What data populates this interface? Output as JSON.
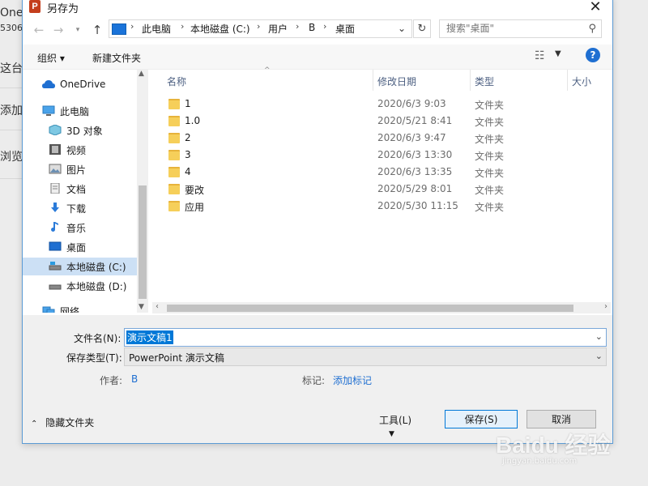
{
  "background": {
    "lines": [
      "OneD",
      "5306",
      "这台电",
      "添加位",
      "浏览"
    ]
  },
  "dialog": {
    "app_icon_label": "P",
    "title": "另存为",
    "close_glyph": "✕"
  },
  "address": {
    "crumbs": [
      "此电脑",
      "本地磁盘 (C:)",
      "用户",
      "B",
      "桌面"
    ],
    "search_placeholder": "搜索\"桌面\""
  },
  "toolbar": {
    "organize": "组织 ▾",
    "new_folder": "新建文件夹",
    "help_glyph": "?"
  },
  "nav": {
    "items": [
      {
        "label": "OneDrive",
        "icon": "cloud-icon"
      },
      {
        "label": "此电脑",
        "icon": "computer-icon"
      },
      {
        "label": "3D 对象",
        "icon": "cube-icon"
      },
      {
        "label": "视频",
        "icon": "video-icon"
      },
      {
        "label": "图片",
        "icon": "picture-icon"
      },
      {
        "label": "文档",
        "icon": "document-icon"
      },
      {
        "label": "下载",
        "icon": "download-icon"
      },
      {
        "label": "音乐",
        "icon": "music-icon"
      },
      {
        "label": "桌面",
        "icon": "desktop-icon"
      },
      {
        "label": "本地磁盘 (C:)",
        "icon": "drive-icon",
        "selected": true
      },
      {
        "label": "本地磁盘 (D:)",
        "icon": "drive-icon"
      },
      {
        "label": "网络",
        "icon": "network-icon"
      }
    ]
  },
  "files": {
    "columns": [
      "名称",
      "修改日期",
      "类型",
      "大小"
    ],
    "rows": [
      {
        "name": "1",
        "date": "2020/6/3 9:03",
        "type": "文件夹"
      },
      {
        "name": "1.0",
        "date": "2020/5/21 8:41",
        "type": "文件夹"
      },
      {
        "name": "2",
        "date": "2020/6/3 9:47",
        "type": "文件夹"
      },
      {
        "name": "3",
        "date": "2020/6/3 13:30",
        "type": "文件夹"
      },
      {
        "name": "4",
        "date": "2020/6/3 13:35",
        "type": "文件夹"
      },
      {
        "name": "要改",
        "date": "2020/5/29 8:01",
        "type": "文件夹"
      },
      {
        "name": "应用",
        "date": "2020/5/30 11:15",
        "type": "文件夹"
      }
    ]
  },
  "form": {
    "filename_label": "文件名(N):",
    "filename_value": "演示文稿1",
    "savetype_label": "保存类型(T):",
    "savetype_value": "PowerPoint 演示文稿",
    "author_label": "作者:",
    "author_value": "B",
    "tags_label": "标记:",
    "tags_value": "添加标记"
  },
  "footer": {
    "hide_folders": "隐藏文件夹",
    "tools": "工具(L)",
    "save": "保存(S)",
    "cancel": "取消"
  },
  "watermark": {
    "logo": "Baidu 经验",
    "url": "jingyan.baidu.com"
  }
}
